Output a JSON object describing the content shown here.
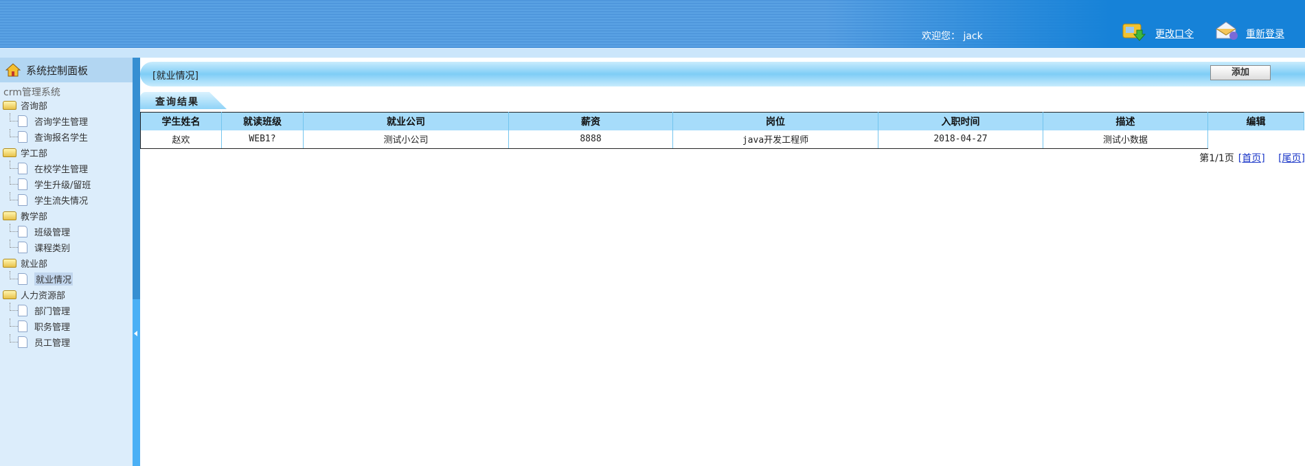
{
  "header": {
    "welcome": "欢迎您： jack",
    "change_password": "更改口令",
    "relogin": "重新登录"
  },
  "sidebar": {
    "title": "系统控制面板",
    "system_name": "crm管理系统",
    "groups": [
      {
        "label": "咨询部",
        "items": [
          "咨询学生管理",
          "查询报名学生"
        ]
      },
      {
        "label": "学工部",
        "items": [
          "在校学生管理",
          "学生升级/留班",
          "学生流失情况"
        ]
      },
      {
        "label": "教学部",
        "items": [
          "班级管理",
          "课程类别"
        ]
      },
      {
        "label": "就业部",
        "items": [
          "就业情况"
        ]
      },
      {
        "label": "人力资源部",
        "items": [
          "部门管理",
          "职务管理",
          "员工管理"
        ]
      }
    ],
    "active_item": "就业情况"
  },
  "main": {
    "title": "[就业情况]",
    "add_label": "添加",
    "tab": "查询结果",
    "columns": [
      "学生姓名",
      "就读班级",
      "就业公司",
      "薪资",
      "岗位",
      "入职时间",
      "描述",
      "编辑"
    ],
    "rows": [
      [
        "赵欢",
        "WEB1?",
        "测试小公司",
        "8888",
        "java开发工程师",
        "2018-04-27",
        "测试小数据"
      ]
    ],
    "pager": {
      "info": "第1/1页",
      "first": "[首页]",
      "last": "[尾页]"
    }
  }
}
